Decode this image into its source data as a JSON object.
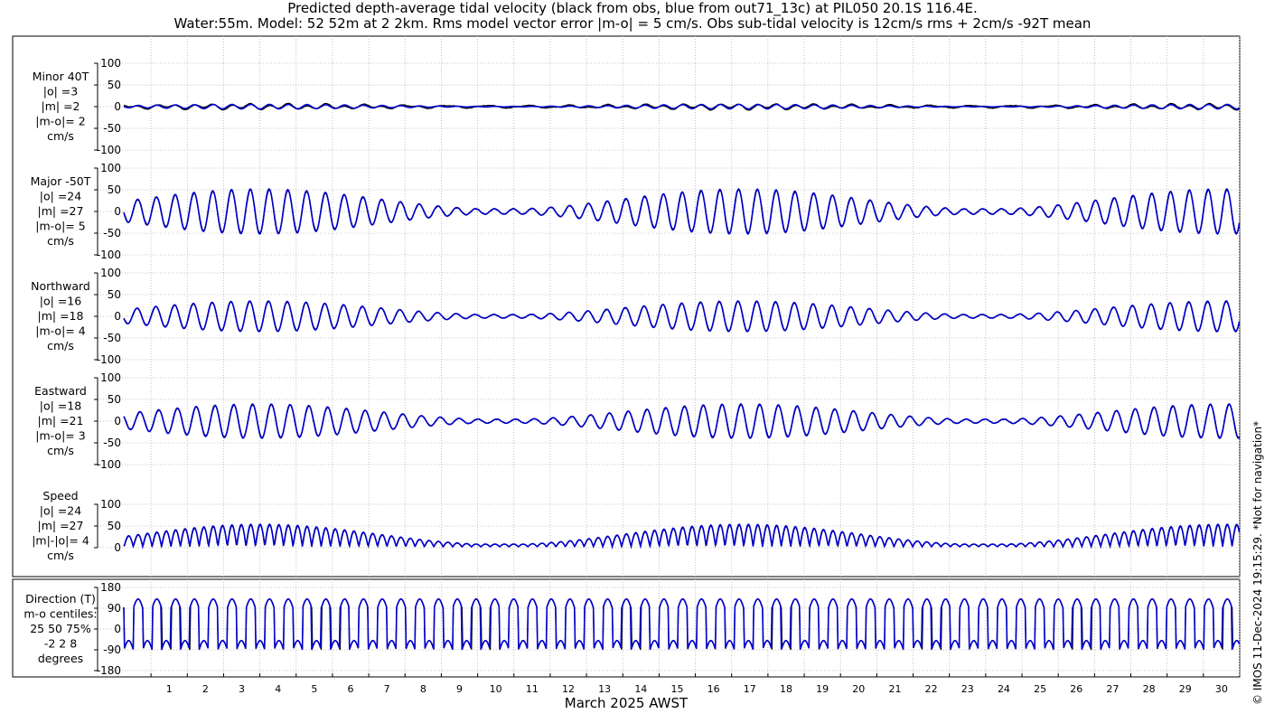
{
  "title_line1": "Predicted depth-average tidal velocity (black from obs, blue from out71_13c) at PIL050 20.1S 116.4E.",
  "title_line2": "Water:55m. Model: 52 52m at 2 2km. Rms model vector error |m-o| = 5 cm/s. Obs sub-tidal velocity is 12cm/s rms + 2cm/s -92T mean",
  "credit": "© IMOS 11-Dec-2024 19:15:29. *Not for navigation*",
  "colors": {
    "obs": "#000000",
    "model": "#0000cc",
    "grid": "#b4b4b4"
  },
  "chart_data": {
    "type": "line",
    "xlabel": "March 2025 AWST",
    "x_ticks": [
      "1",
      "2",
      "3",
      "4",
      "5",
      "6",
      "7",
      "8",
      "9",
      "10",
      "11",
      "12",
      "13",
      "14",
      "15",
      "16",
      "17",
      "18",
      "19",
      "20",
      "21",
      "22",
      "23",
      "24",
      "25",
      "26",
      "27",
      "28",
      "29",
      "30"
    ],
    "xlim_days": [
      0.25,
      31.0
    ],
    "series_names": [
      "obs",
      "out71_13c"
    ],
    "panels": [
      {
        "key": "minor",
        "label": [
          "Minor 40T",
          "|o| =3",
          "|m| =2",
          "|m-o|= 2",
          "cm/s"
        ],
        "ylim": [
          -100,
          100
        ],
        "yticks": [
          "100",
          "50",
          "0",
          "-50",
          "-100"
        ],
        "tick_values": [
          100,
          50,
          0,
          -50,
          -100
        ],
        "kind": "component",
        "amplitude": [
          5,
          3
        ]
      },
      {
        "key": "major",
        "label": [
          "Major -50T",
          "|o| =24",
          "|m| =27",
          "|m-o|= 5",
          "cm/s"
        ],
        "ylim": [
          -100,
          100
        ],
        "yticks": [
          "100",
          "50",
          "0",
          "-50",
          "-100"
        ],
        "tick_values": [
          100,
          50,
          0,
          -50,
          -100
        ],
        "kind": "component",
        "amplitude": [
          50,
          12
        ]
      },
      {
        "key": "north",
        "label": [
          "Northward",
          "|o| =16",
          "|m| =18",
          "|m-o|= 4",
          "cm/s"
        ],
        "ylim": [
          -100,
          100
        ],
        "yticks": [
          "100",
          "50",
          "0",
          "-50",
          "-100"
        ],
        "tick_values": [
          100,
          50,
          0,
          -50,
          -100
        ],
        "kind": "component",
        "amplitude": [
          34,
          8
        ]
      },
      {
        "key": "east",
        "label": [
          "Eastward",
          "|o| =18",
          "|m| =21",
          "|m-o|= 3",
          "cm/s"
        ],
        "ylim": [
          -100,
          100
        ],
        "yticks": [
          "100",
          "50",
          "0",
          "-50",
          "-100"
        ],
        "tick_values": [
          100,
          50,
          0,
          -50,
          -100
        ],
        "kind": "component",
        "amplitude": [
          38,
          9
        ]
      },
      {
        "key": "speed",
        "label": [
          "Speed",
          "|o| =24",
          "|m| =27",
          "|m|-|o|= 4",
          "cm/s"
        ],
        "ylim": [
          0,
          100
        ],
        "yticks": [
          "100",
          "50",
          "0"
        ],
        "tick_values": [
          100,
          50,
          0
        ],
        "kind": "speed",
        "amplitude": [
          50,
          4
        ]
      },
      {
        "key": "direction",
        "label": [
          "Direction (T)",
          "m-o centiles:",
          "25  50  75%",
          "-2  2  8",
          "degrees"
        ],
        "ylim": [
          -180,
          180
        ],
        "yticks": [
          "180",
          "90",
          "0",
          "-90",
          "-180"
        ],
        "tick_values": [
          180,
          90,
          0,
          -90,
          -180
        ],
        "kind": "direction"
      }
    ]
  }
}
